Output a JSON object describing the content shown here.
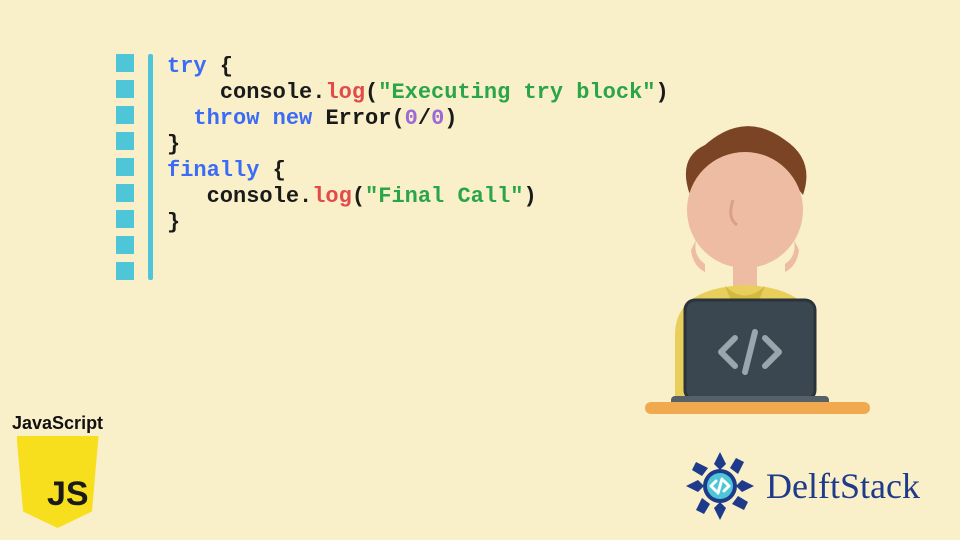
{
  "code": {
    "lines": [
      [
        {
          "t": "try",
          "c": "kw"
        },
        {
          "t": " {",
          "c": "punct"
        }
      ],
      [
        {
          "t": "    ",
          "c": "punct"
        },
        {
          "t": "console",
          "c": "obj"
        },
        {
          "t": ".",
          "c": "dot"
        },
        {
          "t": "log",
          "c": "method"
        },
        {
          "t": "(",
          "c": "punct"
        },
        {
          "t": "\"Executing try block\"",
          "c": "str"
        },
        {
          "t": ")",
          "c": "punct"
        }
      ],
      [
        {
          "t": "  ",
          "c": "punct"
        },
        {
          "t": "throw",
          "c": "kw"
        },
        {
          "t": " ",
          "c": "punct"
        },
        {
          "t": "new",
          "c": "new"
        },
        {
          "t": " ",
          "c": "punct"
        },
        {
          "t": "Error",
          "c": "cls"
        },
        {
          "t": "(",
          "c": "punct"
        },
        {
          "t": "0",
          "c": "num"
        },
        {
          "t": "/",
          "c": "punct"
        },
        {
          "t": "0",
          "c": "num"
        },
        {
          "t": ")",
          "c": "punct"
        }
      ],
      [
        {
          "t": "}",
          "c": "punct"
        }
      ],
      [
        {
          "t": "finally",
          "c": "kw"
        },
        {
          "t": " {",
          "c": "punct"
        }
      ],
      [
        {
          "t": "   ",
          "c": "punct"
        },
        {
          "t": "console",
          "c": "obj"
        },
        {
          "t": ".",
          "c": "dot"
        },
        {
          "t": "log",
          "c": "method"
        },
        {
          "t": "(",
          "c": "punct"
        },
        {
          "t": "\"Final Call\"",
          "c": "str"
        },
        {
          "t": ")",
          "c": "punct"
        }
      ],
      [
        {
          "t": "}",
          "c": "punct"
        }
      ]
    ]
  },
  "logos": {
    "js_label": "JavaScript",
    "js_initials": "JS",
    "delftstack": "DelftStack"
  },
  "illustration": {
    "name": "person-with-laptop",
    "laptop_icon": "code-brackets-icon"
  },
  "colors": {
    "bg": "#f9efc8",
    "accent": "#4fc5d8",
    "keyword": "#3b6cf6",
    "method": "#e34b4b",
    "string": "#2aa54a",
    "number": "#9a6bd6",
    "js_yellow": "#f7df1e",
    "delft_blue": "#1e3a8a"
  }
}
